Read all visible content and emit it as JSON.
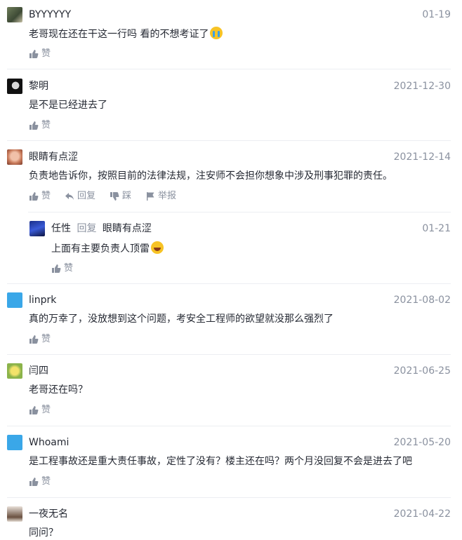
{
  "like_label": "赞",
  "reply_label": "回复",
  "dislike_label": "踩",
  "report_label": "举报",
  "comments": [
    {
      "name": "BYYYYYY",
      "time": "01-19",
      "text": "老哥现在还在干这一行吗 看的不想考证了"
    },
    {
      "name": "黎明",
      "time": "2021-12-30",
      "text": "是不是已经进去了"
    },
    {
      "name": "眼睛有点涩",
      "time": "2021-12-14",
      "text": "负责地告诉你，按照目前的法律法规，注安师不会担你想象中涉及刑事犯罪的责任。",
      "reply": {
        "name": "任性",
        "reply_word": "回复",
        "target": "眼睛有点涩",
        "time": "01-21",
        "text": "上面有主要负责人顶雷"
      }
    },
    {
      "name": "linprk",
      "time": "2021-08-02",
      "text": "真的万幸了，没放想到这个问题，考安全工程师的欲望就没那么强烈了"
    },
    {
      "name": "闫四",
      "time": "2021-06-25",
      "text": "老哥还在吗？"
    },
    {
      "name": "Whoami",
      "time": "2021-05-20",
      "text": "是工程事故还是重大责任事故，定性了没有？楼主还在吗？两个月没回复不会是进去了吧"
    },
    {
      "name": "一夜无名",
      "time": "2021-04-22",
      "text": "同问？"
    }
  ],
  "colors": {
    "text": "#252933",
    "meta": "#8a919f",
    "divider": "#eceef2"
  }
}
